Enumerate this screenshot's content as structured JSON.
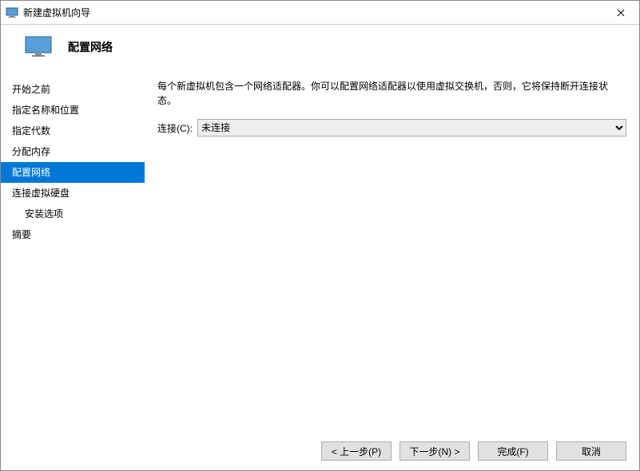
{
  "window": {
    "title": "新建虚拟机向导"
  },
  "header": {
    "page_title": "配置网络"
  },
  "sidebar": {
    "items": [
      {
        "label": "开始之前",
        "indent": false
      },
      {
        "label": "指定名称和位置",
        "indent": false
      },
      {
        "label": "指定代数",
        "indent": false
      },
      {
        "label": "分配内存",
        "indent": false
      },
      {
        "label": "配置网络",
        "indent": false,
        "selected": true
      },
      {
        "label": "连接虚拟硬盘",
        "indent": false
      },
      {
        "label": "安装选项",
        "indent": true
      },
      {
        "label": "摘要",
        "indent": false
      }
    ]
  },
  "content": {
    "description": "每个新虚拟机包含一个网络适配器。你可以配置网络适配器以使用虚拟交换机，否则，它将保持断开连接状态。",
    "connection_label": "连接(C):",
    "connection_selected": "未连接",
    "connection_options": [
      "未连接"
    ]
  },
  "footer": {
    "back": "< 上一步(P)",
    "next": "下一步(N) >",
    "finish": "完成(F)",
    "cancel": "取消"
  }
}
